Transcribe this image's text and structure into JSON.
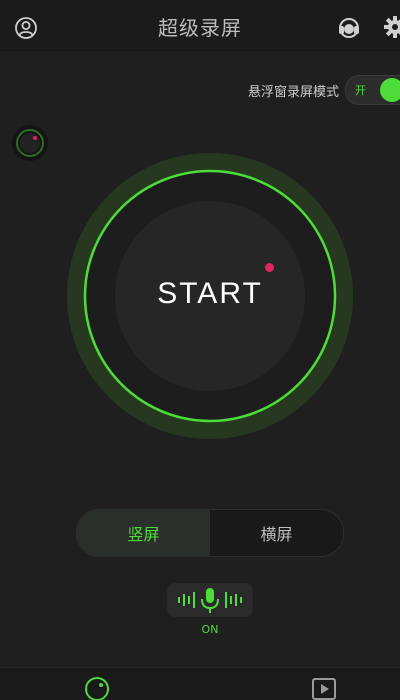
{
  "header": {
    "title": "超级录屏",
    "icons": {
      "user": "user-icon",
      "support": "headset-icon",
      "settings": "gear-icon"
    }
  },
  "floating_mode": {
    "label": "悬浮窗录屏模式",
    "toggle_state": "开",
    "enabled": true
  },
  "start_button": {
    "label": "START"
  },
  "orientation": {
    "options": [
      {
        "label": "竖屏",
        "selected": true
      },
      {
        "label": "横屏",
        "selected": false
      }
    ]
  },
  "microphone": {
    "state": "ON",
    "icon": "microphone-icon"
  },
  "bottom_nav": {
    "items": [
      {
        "name": "record",
        "icon": "record-icon",
        "active": true
      },
      {
        "name": "videos",
        "icon": "play-icon",
        "active": false
      }
    ]
  },
  "colors": {
    "accent": "#4ddc3a",
    "record_dot": "#e0245e",
    "background": "#1f1f1f"
  }
}
